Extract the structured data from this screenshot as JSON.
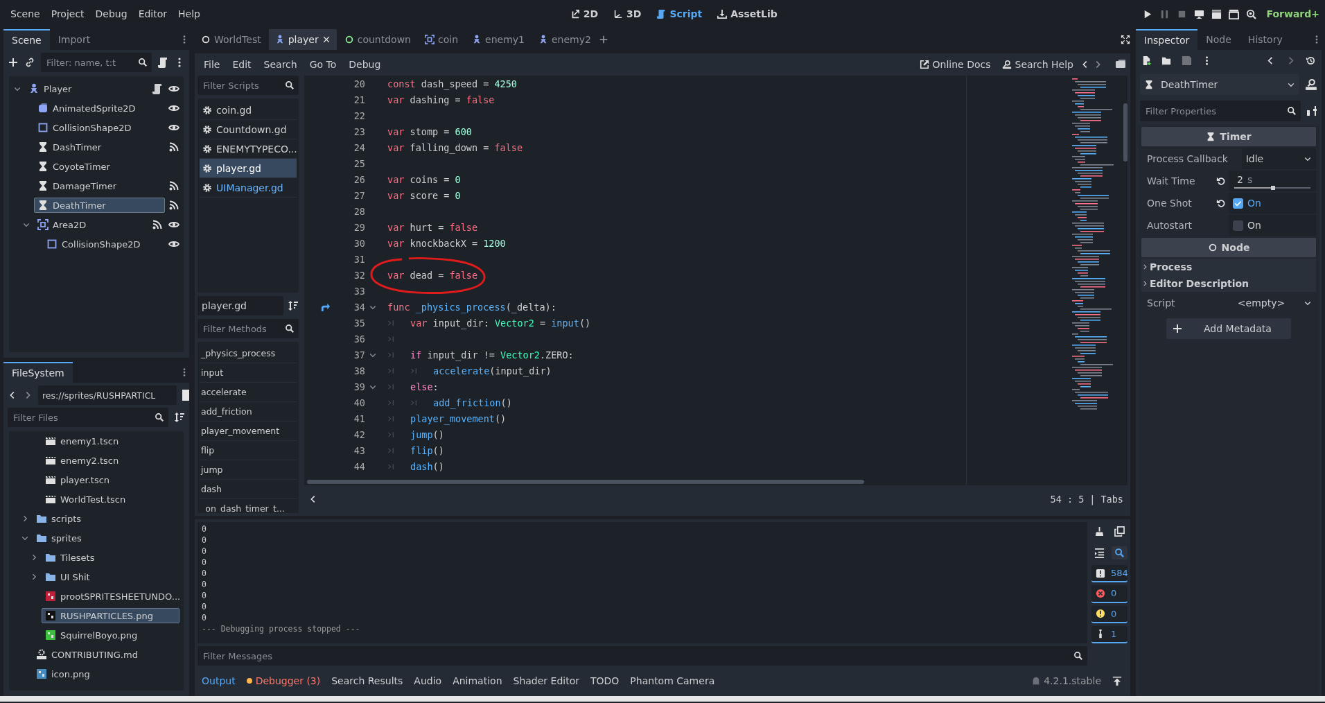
{
  "menu_bar": {
    "menus": [
      "Scene",
      "Project",
      "Debug",
      "Editor",
      "Help"
    ],
    "workspaces": [
      {
        "kind": "planar",
        "label": "2D",
        "selected": false
      },
      {
        "kind": "spatial",
        "label": "3D",
        "selected": false
      },
      {
        "kind": "script",
        "label": "Script",
        "selected": true
      },
      {
        "kind": "assetlib",
        "label": "AssetLib",
        "selected": false
      }
    ],
    "run_buttons": [
      {
        "kind": "play",
        "disabled": false
      },
      {
        "kind": "pause",
        "disabled": true
      },
      {
        "kind": "stop",
        "disabled": true
      },
      {
        "kind": "remote",
        "disabled": false
      },
      {
        "kind": "playscene",
        "disabled": false
      },
      {
        "kind": "playcustom",
        "disabled": false
      },
      {
        "kind": "movie",
        "disabled": false
      }
    ],
    "renderer": "Forward+"
  },
  "scene_dock": {
    "tabs": [
      {
        "label": "Scene",
        "selected": true
      },
      {
        "label": "Import",
        "selected": false
      }
    ],
    "filter": {
      "placeholder": "Filter: name, t:t"
    },
    "tree": [
      {
        "name": "Player",
        "kind": "character",
        "selected": false,
        "expanded": true,
        "script": true,
        "visible": true,
        "children": [
          {
            "name": "AnimatedSprite2D",
            "kind": "sprite",
            "selected": false,
            "visible": true
          },
          {
            "name": "CollisionShape2D",
            "kind": "shape",
            "selected": false,
            "visible": true
          },
          {
            "name": "DashTimer",
            "kind": "timer",
            "selected": false,
            "signals": true
          },
          {
            "name": "CoyoteTimer",
            "kind": "timer",
            "selected": false
          },
          {
            "name": "DamageTimer",
            "kind": "timer",
            "selected": false,
            "signals": true
          },
          {
            "name": "DeathTimer",
            "kind": "timer",
            "selected": true,
            "signals": true
          },
          {
            "name": "Area2D",
            "kind": "area",
            "selected": false,
            "expanded": true,
            "signals": true,
            "visible": true,
            "children": [
              {
                "name": "CollisionShape2D",
                "kind": "shape",
                "selected": false,
                "visible": true
              }
            ]
          }
        ]
      }
    ]
  },
  "filesystem": {
    "tab": "FileSystem",
    "path": "res://sprites/RUSHPARTICL",
    "filter": {
      "placeholder": "Filter Files"
    },
    "tree": [
      {
        "kind": "group",
        "children": [
          {
            "kind": "scene",
            "name": "enemy1.tscn",
            "selected": false
          },
          {
            "kind": "scene",
            "name": "enemy2.tscn",
            "selected": false
          },
          {
            "kind": "scene",
            "name": "player.tscn",
            "selected": false
          },
          {
            "kind": "scene",
            "name": "WorldTest.tscn",
            "selected": false
          }
        ]
      },
      {
        "kind": "folder",
        "name": "scripts",
        "expanded": false,
        "selected": false
      },
      {
        "kind": "folder",
        "name": "sprites",
        "expanded": true,
        "selected": false,
        "children": [
          {
            "kind": "folder",
            "name": "Tilesets",
            "expanded": false,
            "selected": false
          },
          {
            "kind": "folder",
            "name": "UI Shit",
            "expanded": false,
            "selected": false
          },
          {
            "kind": "image",
            "name": "prootSPRITESHEETUNDO...",
            "color": "#c0203a",
            "selected": false
          },
          {
            "kind": "image",
            "name": "RUSHPARTICLES.png",
            "color": "#111111",
            "selected": true
          },
          {
            "kind": "image",
            "name": "SquirrelBoyo.png",
            "color": "#3fbf3f",
            "selected": false
          }
        ]
      },
      {
        "kind": "text",
        "name": "CONTRIBUTING.md",
        "selected": false
      },
      {
        "kind": "image",
        "name": "icon.png",
        "color": "#478cbf",
        "selected": false
      }
    ]
  },
  "script_editor": {
    "tabs": [
      {
        "label": "WorldTest",
        "kind": "node",
        "selected": false
      },
      {
        "label": "player",
        "kind": "character",
        "selected": true
      },
      {
        "label": "countdown",
        "kind": "control",
        "selected": false
      },
      {
        "label": "coin",
        "kind": "area",
        "selected": false
      },
      {
        "label": "enemy1",
        "kind": "character",
        "selected": false
      },
      {
        "label": "enemy2",
        "kind": "character",
        "selected": false
      }
    ],
    "menus": [
      "File",
      "Edit",
      "Search",
      "Go To",
      "Debug"
    ],
    "help_buttons": [
      {
        "kind": "docs",
        "label": "Online Docs"
      },
      {
        "kind": "help",
        "label": "Search Help"
      }
    ],
    "scripts_filter": {
      "placeholder": "Filter Scripts"
    },
    "scripts": [
      {
        "name": "coin.gd",
        "selected": false,
        "color": "#cdcfd2"
      },
      {
        "name": "Countdown.gd",
        "selected": false,
        "color": "#cdcfd2"
      },
      {
        "name": "ENEMYTYPECO...",
        "selected": false,
        "color": "#cdcfd2"
      },
      {
        "name": "player.gd",
        "selected": true,
        "color": "#ffffff"
      },
      {
        "name": "UIManager.gd",
        "selected": false,
        "color": "#6cb4ff"
      }
    ],
    "current_script": "player.gd",
    "methods_filter": {
      "placeholder": "Filter Methods"
    },
    "methods": [
      {
        "name": "_physics_process",
        "selected": false
      },
      {
        "name": "input",
        "selected": false
      },
      {
        "name": "accelerate",
        "selected": false
      },
      {
        "name": "add_friction",
        "selected": false
      },
      {
        "name": "player_movement",
        "selected": false
      },
      {
        "name": "flip",
        "selected": false
      },
      {
        "name": "jump",
        "selected": false
      },
      {
        "name": "dash",
        "selected": false
      },
      {
        "name": "_on_dash_timer_t...",
        "selected": false
      }
    ],
    "code": [
      {
        "number": "20",
        "tokens": [
          {
            "kind": "keyword",
            "text": "const"
          },
          {
            "kind": "plain",
            "text": " dash_speed = "
          },
          {
            "kind": "number",
            "text": "4250"
          }
        ]
      },
      {
        "number": "21",
        "tokens": [
          {
            "kind": "keyword",
            "text": "var"
          },
          {
            "kind": "plain",
            "text": " dashing = "
          },
          {
            "kind": "keyword",
            "text": "false"
          }
        ]
      },
      {
        "number": "22"
      },
      {
        "number": "23",
        "tokens": [
          {
            "kind": "keyword",
            "text": "var"
          },
          {
            "kind": "plain",
            "text": " stomp = "
          },
          {
            "kind": "number",
            "text": "600"
          }
        ]
      },
      {
        "number": "24",
        "tokens": [
          {
            "kind": "keyword",
            "text": "var"
          },
          {
            "kind": "plain",
            "text": " falling_down = "
          },
          {
            "kind": "keyword",
            "text": "false"
          }
        ]
      },
      {
        "number": "25"
      },
      {
        "number": "26",
        "tokens": [
          {
            "kind": "keyword",
            "text": "var"
          },
          {
            "kind": "plain",
            "text": " coins = "
          },
          {
            "kind": "number",
            "text": "0"
          }
        ]
      },
      {
        "number": "27",
        "tokens": [
          {
            "kind": "keyword",
            "text": "var"
          },
          {
            "kind": "plain",
            "text": " score = "
          },
          {
            "kind": "number",
            "text": "0"
          }
        ]
      },
      {
        "number": "28"
      },
      {
        "number": "29",
        "tokens": [
          {
            "kind": "keyword",
            "text": "var"
          },
          {
            "kind": "plain",
            "text": " hurt = "
          },
          {
            "kind": "keyword",
            "text": "false"
          }
        ]
      },
      {
        "number": "30",
        "tokens": [
          {
            "kind": "keyword",
            "text": "var"
          },
          {
            "kind": "plain",
            "text": " knockbackX = "
          },
          {
            "kind": "number",
            "text": "1200"
          }
        ]
      },
      {
        "number": "31"
      },
      {
        "number": "32",
        "circled": true,
        "tokens": [
          {
            "kind": "keyword",
            "text": "var"
          },
          {
            "kind": "plain",
            "text": " dead = "
          },
          {
            "kind": "keyword",
            "text": "false"
          }
        ]
      },
      {
        "number": "33"
      },
      {
        "number": "34",
        "foldable": true,
        "override": true,
        "tokens": [
          {
            "kind": "keyword",
            "text": "func"
          },
          {
            "kind": "function",
            "text": "_physics_process",
            "spaced": true
          },
          {
            "kind": "plain",
            "text": "(_delta):"
          }
        ]
      },
      {
        "number": "35",
        "tokens": [
          {
            "kind": "tab"
          },
          {
            "kind": "keyword",
            "text": "var"
          },
          {
            "kind": "plain",
            "text": " input_dir: "
          },
          {
            "kind": "type",
            "text": "Vector2"
          },
          {
            "kind": "plain",
            "text": " = "
          },
          {
            "kind": "function",
            "text": "input"
          },
          {
            "kind": "plain",
            "text": "()"
          }
        ]
      },
      {
        "number": "36",
        "tokens": [
          {
            "kind": "tab"
          }
        ]
      },
      {
        "number": "37",
        "foldable": true,
        "tokens": [
          {
            "kind": "tab"
          },
          {
            "kind": "control",
            "text": "if"
          },
          {
            "kind": "plain",
            "text": " input_dir != "
          },
          {
            "kind": "type",
            "text": "Vector2"
          },
          {
            "kind": "plain",
            "text": ".ZERO:"
          }
        ]
      },
      {
        "number": "38",
        "tokens": [
          {
            "kind": "tab"
          },
          {
            "kind": "tab"
          },
          {
            "kind": "function",
            "text": "accelerate"
          },
          {
            "kind": "plain",
            "text": "(input_dir)"
          }
        ]
      },
      {
        "number": "39",
        "foldable": true,
        "tokens": [
          {
            "kind": "tab"
          },
          {
            "kind": "control",
            "text": "else"
          },
          {
            "kind": "plain",
            "text": ":"
          }
        ]
      },
      {
        "number": "40",
        "tokens": [
          {
            "kind": "tab"
          },
          {
            "kind": "tab"
          },
          {
            "kind": "function",
            "text": "add_friction"
          },
          {
            "kind": "plain",
            "text": "()"
          }
        ]
      },
      {
        "number": "41",
        "tokens": [
          {
            "kind": "tab"
          },
          {
            "kind": "function",
            "text": "player_movement"
          },
          {
            "kind": "plain",
            "text": "()"
          }
        ]
      },
      {
        "number": "42",
        "tokens": [
          {
            "kind": "tab"
          },
          {
            "kind": "function",
            "text": "jump"
          },
          {
            "kind": "plain",
            "text": "()"
          }
        ]
      },
      {
        "number": "43",
        "tokens": [
          {
            "kind": "tab"
          },
          {
            "kind": "function",
            "text": "flip"
          },
          {
            "kind": "plain",
            "text": "()"
          }
        ]
      },
      {
        "number": "44",
        "tokens": [
          {
            "kind": "tab"
          },
          {
            "kind": "function",
            "text": "dash"
          },
          {
            "kind": "plain",
            "text": "()"
          }
        ]
      }
    ],
    "cursor": "54 :   5",
    "separator": "|",
    "indent_mode": "Tabs"
  },
  "bottom_panel": {
    "output": [
      "0",
      "0",
      "0",
      "0",
      "0",
      "0",
      "0",
      "0",
      "0",
      "--- Debugging process stopped ---"
    ],
    "tools": [
      {
        "kind": "clear",
        "on": false
      },
      {
        "kind": "copy",
        "on": false
      },
      {
        "kind": "collapse",
        "on": false
      },
      {
        "kind": "search",
        "on": true
      }
    ],
    "filters": [
      {
        "kind": "message",
        "count": "584",
        "on": true
      },
      {
        "kind": "error",
        "count": "0",
        "on": true
      },
      {
        "kind": "warning",
        "count": "0",
        "on": true
      },
      {
        "kind": "editor",
        "count": "1",
        "on": true
      }
    ],
    "filter": {
      "placeholder": "Filter Messages"
    },
    "tabs": [
      {
        "label": "Output",
        "selected": true,
        "alert": false
      },
      {
        "label": "Debugger (3)",
        "selected": false,
        "alert": true
      },
      {
        "label": "Search Results",
        "selected": false,
        "alert": false
      },
      {
        "label": "Audio",
        "selected": false,
        "alert": false
      },
      {
        "label": "Animation",
        "selected": false,
        "alert": false
      },
      {
        "label": "Shader Editor",
        "selected": false,
        "alert": false
      },
      {
        "label": "TODO",
        "selected": false,
        "alert": false
      },
      {
        "label": "Phantom Camera",
        "selected": false,
        "alert": false
      }
    ],
    "version": "4.2.1.stable"
  },
  "inspector": {
    "tabs": [
      {
        "label": "Inspector",
        "selected": true
      },
      {
        "label": "Node",
        "selected": false
      },
      {
        "label": "History",
        "selected": false
      }
    ],
    "toolbar": [
      {
        "kind": "new",
        "disabled": false
      },
      {
        "kind": "open",
        "disabled": false
      },
      {
        "kind": "save",
        "disabled": true
      },
      {
        "kind": "more",
        "disabled": false
      },
      {
        "kind": "back",
        "disabled": false
      },
      {
        "kind": "forward",
        "disabled": true
      },
      {
        "kind": "history",
        "disabled": false
      }
    ],
    "object": "DeathTimer",
    "filter": {
      "placeholder": "Filter Properties"
    },
    "properties": [
      {
        "kind": "timersection",
        "title": "Timer"
      },
      {
        "kind": "dropdown",
        "label": "Process Callback",
        "value": "Idle"
      },
      {
        "kind": "slider",
        "label": "Wait Time",
        "value": "2",
        "unit": "s",
        "level": 0.51,
        "revertable": true
      },
      {
        "kind": "checkbox",
        "label": "One Shot",
        "value": "On",
        "checked": true,
        "revertable": true
      },
      {
        "kind": "checkbox",
        "label": "Autostart",
        "value": "On",
        "checked": false
      },
      {
        "kind": "nodesection",
        "title": "Node"
      },
      {
        "kind": "group",
        "title": "Process",
        "expanded": false
      },
      {
        "kind": "group",
        "title": "Editor Description",
        "expanded": false
      },
      {
        "kind": "resource",
        "label": "Script",
        "value": "<empty>"
      }
    ],
    "add_metadata": "Add Metadata"
  }
}
